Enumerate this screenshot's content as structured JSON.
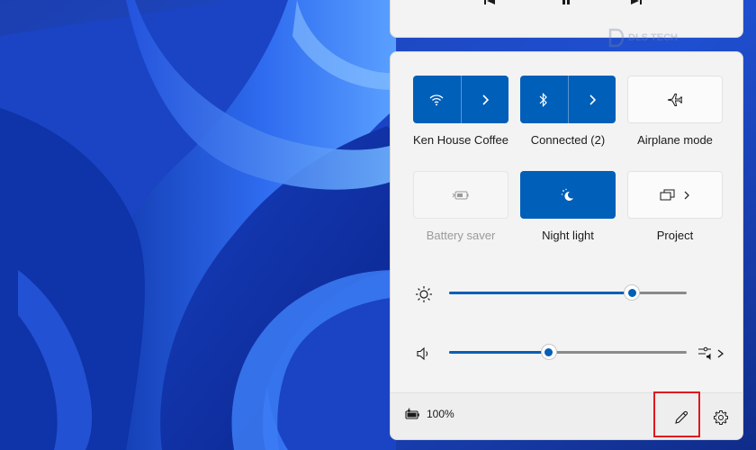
{
  "colors": {
    "accent": "#005fb8",
    "highlight": "#e0191f",
    "panel": "#f3f3f3"
  },
  "media": {
    "buttons": [
      "previous-icon",
      "play-pause-icon",
      "next-icon"
    ]
  },
  "watermark": {
    "text": "DLS TECH"
  },
  "quick_settings": {
    "tiles": [
      {
        "name": "wifi",
        "label": "Ken House Coffee",
        "icon": "wifi-icon",
        "state": "on",
        "has_arrow": true
      },
      {
        "name": "bluetooth",
        "label": "Connected (2)",
        "icon": "bluetooth-icon",
        "state": "on",
        "has_arrow": true
      },
      {
        "name": "airplane",
        "label": "Airplane mode",
        "icon": "airplane-icon",
        "state": "off",
        "has_arrow": false
      },
      {
        "name": "battery-saver",
        "label": "Battery saver",
        "icon": "battery-saver-icon",
        "state": "disabled",
        "has_arrow": false
      },
      {
        "name": "night-light",
        "label": "Night light",
        "icon": "night-light-icon",
        "state": "on",
        "has_arrow": false
      },
      {
        "name": "project",
        "label": "Project",
        "icon": "project-icon",
        "state": "off",
        "has_arrow": true
      }
    ]
  },
  "sliders": {
    "brightness": {
      "icon": "brightness-icon",
      "level": 0.77
    },
    "volume": {
      "icon": "speaker-icon",
      "level": 0.42,
      "trailing_icon": "audio-output-icon"
    }
  },
  "footer": {
    "battery_icon": "battery-charging-icon",
    "battery_text": "100%",
    "edit_icon": "edit-pencil-icon",
    "settings_icon": "settings-gear-icon"
  }
}
